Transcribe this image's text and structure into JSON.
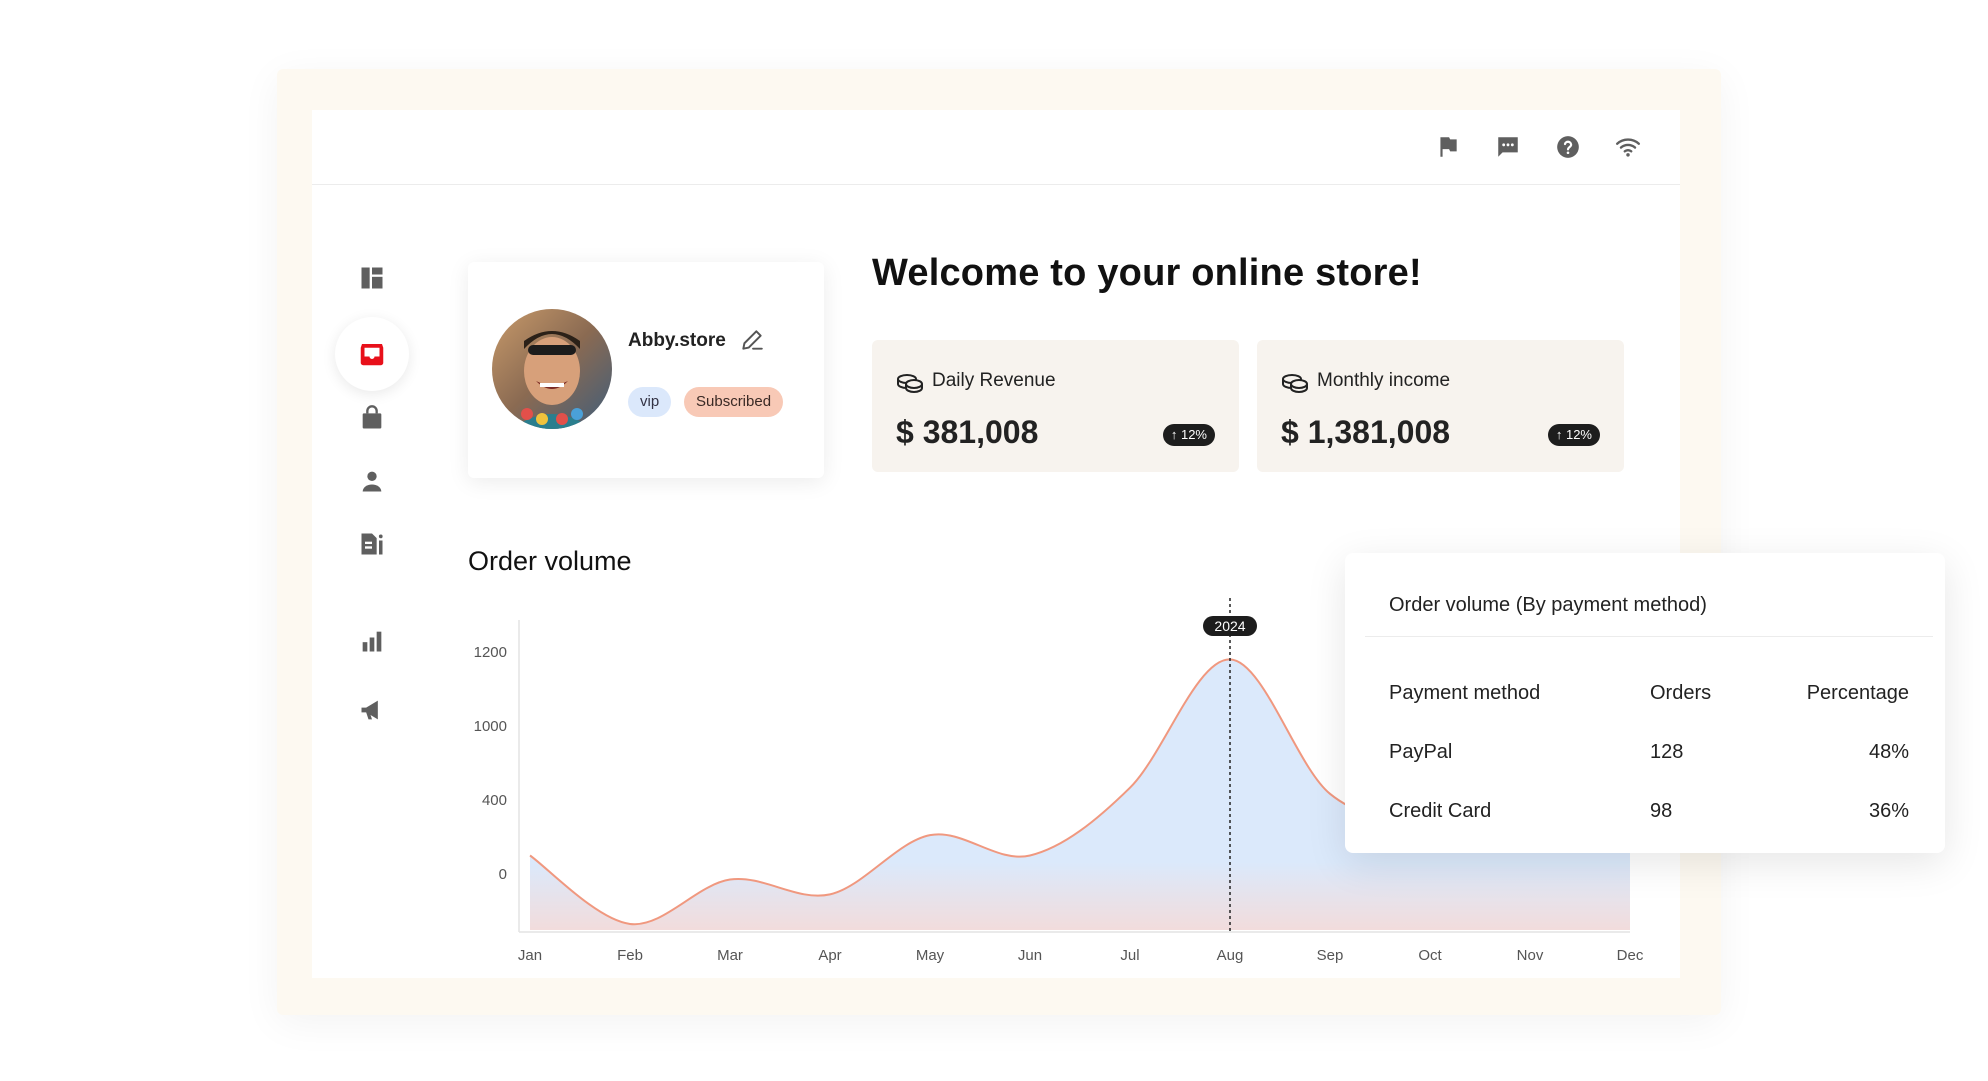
{
  "topbar": {
    "icons": [
      "flag-icon",
      "chat-icon",
      "help-icon",
      "wifi-icon"
    ]
  },
  "sidebar": {
    "items": [
      {
        "icon": "dashboard-icon",
        "active": false
      },
      {
        "icon": "inbox-icon",
        "active": true
      },
      {
        "icon": "shopping-bag-icon",
        "active": false
      },
      {
        "icon": "user-icon",
        "active": false
      },
      {
        "icon": "document-info-icon",
        "active": false
      },
      {
        "icon": "bar-chart-icon",
        "active": false
      },
      {
        "icon": "megaphone-icon",
        "active": false
      }
    ]
  },
  "profile": {
    "name": "Abby.store",
    "badges": {
      "vip": "vip",
      "subscribed": "Subscribed"
    }
  },
  "welcome": "Welcome to your online store!",
  "stats": [
    {
      "label": "Daily Revenue",
      "value": "$ 381,008",
      "change": "↑ 12%"
    },
    {
      "label": "Monthly income",
      "value": "$ 1,381,008",
      "change": "↑ 12%"
    }
  ],
  "order_volume": {
    "title": "Order volume",
    "marker_label": "2024"
  },
  "chart_data": {
    "type": "area",
    "title": "Order volume",
    "categories": [
      "Jan",
      "Feb",
      "Mar",
      "Apr",
      "May",
      "Jun",
      "Jul",
      "Aug",
      "Sep",
      "Oct",
      "Nov",
      "Dec"
    ],
    "y_ticks": [
      "1200",
      "1000",
      "400",
      "0"
    ],
    "series": [
      {
        "values": [
          100,
          -270,
          -30,
          -110,
          210,
          100,
          500,
          1180,
          450,
          280,
          300,
          350
        ]
      }
    ],
    "highlight": {
      "category": "Aug",
      "label": "2024"
    },
    "colors": {
      "line": "#f0987f",
      "fill_top": "#dbe9fb",
      "fill_bottom": "#f2dcdc"
    }
  },
  "payment_table": {
    "title": "Order volume (By payment method)",
    "headers": [
      "Payment method",
      "Orders",
      "Percentage"
    ],
    "rows": [
      [
        "PayPal",
        "128",
        "48%"
      ],
      [
        "Credit Card",
        "98",
        "36%"
      ]
    ]
  }
}
